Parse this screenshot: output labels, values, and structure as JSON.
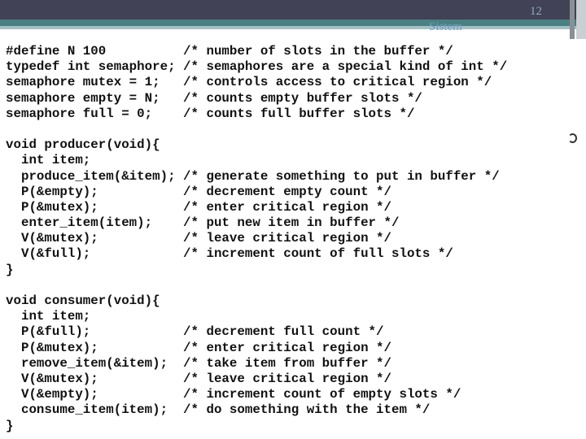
{
  "slide": {
    "page_number": "12",
    "header_text": "Sistem"
  },
  "code_lines": [
    "#define N 100          /* number of slots in the buffer */",
    "typedef int semaphore; /* semaphores are a special kind of int */",
    "semaphore mutex = 1;   /* controls access to critical region */",
    "semaphore empty = N;   /* counts empty buffer slots */",
    "semaphore full = 0;    /* counts full buffer slots */",
    "",
    "void producer(void){",
    "  int item;",
    "  produce_item(&item); /* generate something to put in buffer */",
    "  P(&empty);           /* decrement empty count */",
    "  P(&mutex);           /* enter critical region */",
    "  enter_item(item);    /* put new item in buffer */",
    "  V(&mutex);           /* leave critical region */",
    "  V(&full);            /* increment count of full slots */",
    "}",
    "",
    "void consumer(void){",
    "  int item;",
    "  P(&full);            /* decrement full count */",
    "  P(&mutex);           /* enter critical region */",
    "  remove_item(&item);  /* take item from buffer */",
    "  V(&mutex);           /* leave critical region */",
    "  V(&empty);           /* increment count of empty slots */",
    "  consume_item(item);  /* do something with the item */",
    "}"
  ]
}
